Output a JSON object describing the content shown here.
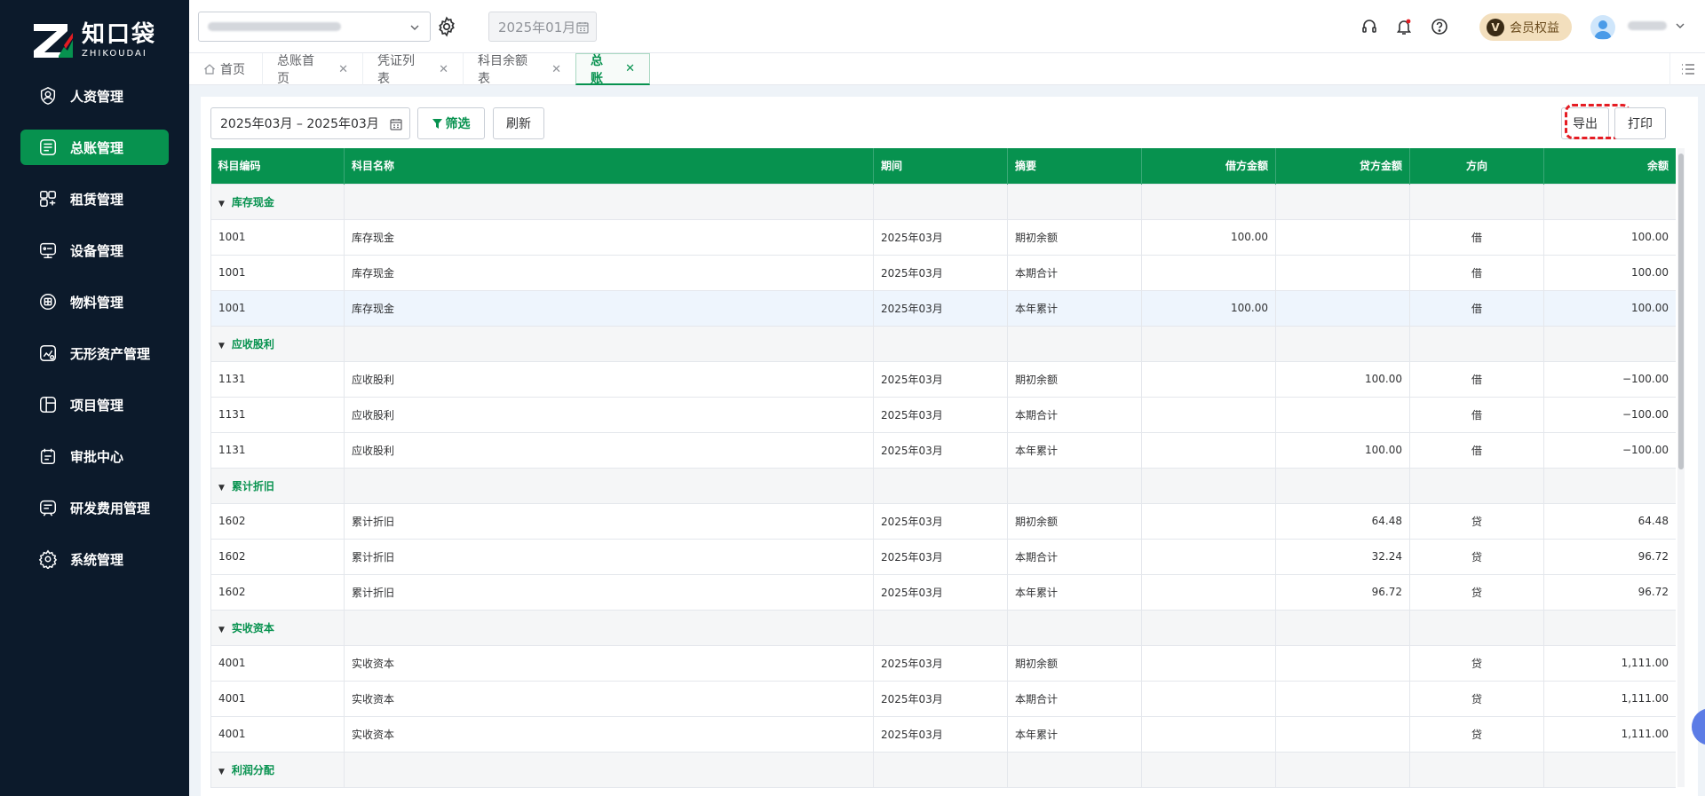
{
  "app": {
    "logo_cn": "知口袋",
    "logo_en": "ZHIKOUDAI"
  },
  "sidebar": {
    "items": [
      {
        "label": "人资管理",
        "icon": "hr-icon"
      },
      {
        "label": "总账管理",
        "icon": "ledger-icon",
        "active": true
      },
      {
        "label": "租赁管理",
        "icon": "lease-icon"
      },
      {
        "label": "设备管理",
        "icon": "device-icon"
      },
      {
        "label": "物料管理",
        "icon": "material-icon"
      },
      {
        "label": "无形资产管理",
        "icon": "intangible-asset-icon"
      },
      {
        "label": "项目管理",
        "icon": "project-icon"
      },
      {
        "label": "审批中心",
        "icon": "approval-icon"
      },
      {
        "label": "研发费用管理",
        "icon": "rd-expense-icon"
      },
      {
        "label": "系统管理",
        "icon": "system-gear-icon"
      }
    ]
  },
  "header": {
    "period": "2025年01月",
    "vip_badge": "V",
    "vip_label": "会员权益"
  },
  "tabs": [
    {
      "label": "首页",
      "closable": false
    },
    {
      "label": "总账首页",
      "closable": true
    },
    {
      "label": "凭证列表",
      "closable": true
    },
    {
      "label": "科目余额表",
      "closable": true
    },
    {
      "label": "总账",
      "closable": true,
      "active": true
    }
  ],
  "toolbar": {
    "date_range": "2025年03月 – 2025年03月",
    "filter_label": "筛选",
    "refresh_label": "刷新",
    "export_label": "导出",
    "print_label": "打印"
  },
  "table": {
    "columns": [
      "科目编码",
      "科目名称",
      "期间",
      "摘要",
      "借方金额",
      "贷方金额",
      "方向",
      "余额"
    ],
    "groups": [
      {
        "name": "库存现金",
        "rows": [
          [
            "1001",
            "库存现金",
            "2025年03月",
            "期初余额",
            "100.00",
            "",
            "借",
            "100.00"
          ],
          [
            "1001",
            "库存现金",
            "2025年03月",
            "本期合计",
            "",
            "",
            "借",
            "100.00"
          ],
          [
            "1001",
            "库存现金",
            "2025年03月",
            "本年累计",
            "100.00",
            "",
            "借",
            "100.00"
          ]
        ]
      },
      {
        "name": "应收股利",
        "rows": [
          [
            "1131",
            "应收股利",
            "2025年03月",
            "期初余额",
            "",
            "100.00",
            "借",
            "−100.00"
          ],
          [
            "1131",
            "应收股利",
            "2025年03月",
            "本期合计",
            "",
            "",
            "借",
            "−100.00"
          ],
          [
            "1131",
            "应收股利",
            "2025年03月",
            "本年累计",
            "",
            "100.00",
            "借",
            "−100.00"
          ]
        ]
      },
      {
        "name": "累计折旧",
        "rows": [
          [
            "1602",
            "累计折旧",
            "2025年03月",
            "期初余额",
            "",
            "64.48",
            "贷",
            "64.48"
          ],
          [
            "1602",
            "累计折旧",
            "2025年03月",
            "本期合计",
            "",
            "32.24",
            "贷",
            "96.72"
          ],
          [
            "1602",
            "累计折旧",
            "2025年03月",
            "本年累计",
            "",
            "96.72",
            "贷",
            "96.72"
          ]
        ]
      },
      {
        "name": "实收资本",
        "rows": [
          [
            "4001",
            "实收资本",
            "2025年03月",
            "期初余额",
            "",
            "",
            "贷",
            "1,111.00"
          ],
          [
            "4001",
            "实收资本",
            "2025年03月",
            "本期合计",
            "",
            "",
            "贷",
            "1,111.00"
          ],
          [
            "4001",
            "实收资本",
            "2025年03月",
            "本年累计",
            "",
            "",
            "贷",
            "1,111.00"
          ]
        ]
      },
      {
        "name": "利润分配",
        "rows": []
      }
    ]
  },
  "colors": {
    "brand": "#07924f",
    "sidebar_bg": "#0c1a2b",
    "export_highlight": "#e51c23"
  }
}
